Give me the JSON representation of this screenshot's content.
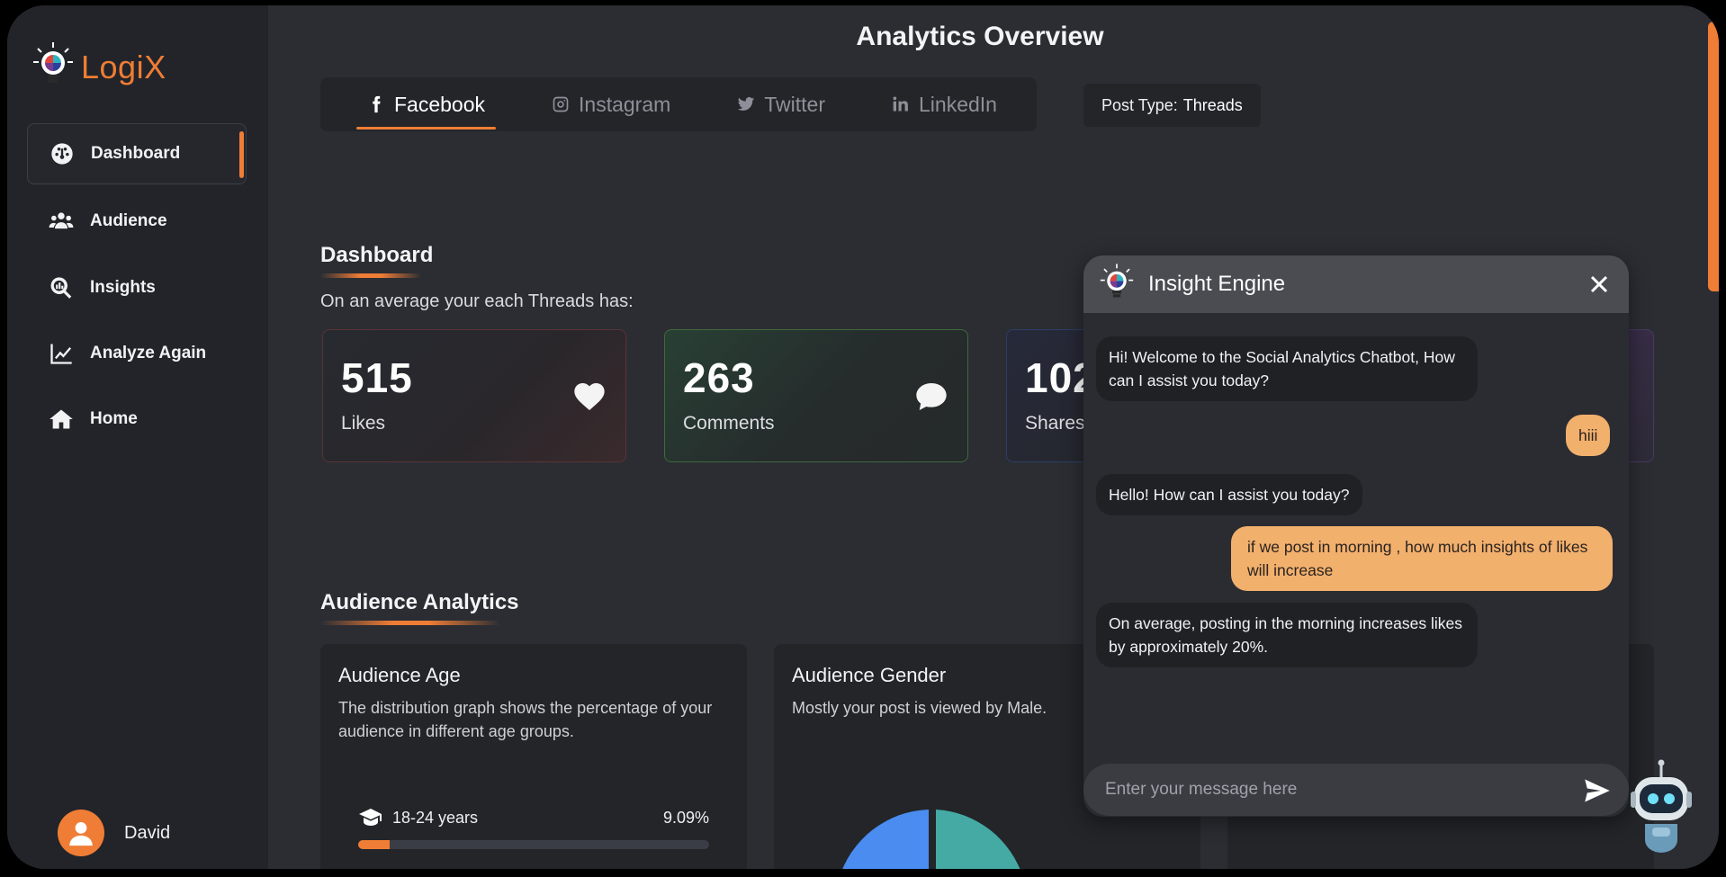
{
  "app": {
    "brand": "LogiX"
  },
  "sidebar": {
    "items": [
      {
        "label": "Dashboard",
        "icon": "dashboard-gauge-icon",
        "active": true
      },
      {
        "label": "Audience",
        "icon": "users-icon"
      },
      {
        "label": "Insights",
        "icon": "search-chart-icon"
      },
      {
        "label": "Analyze Again",
        "icon": "line-chart-icon"
      },
      {
        "label": "Home",
        "icon": "home-icon"
      }
    ],
    "user": {
      "name": "David"
    }
  },
  "header": {
    "title": "Analytics Overview"
  },
  "tabs": [
    {
      "label": "Facebook",
      "icon": "facebook-icon",
      "active": true
    },
    {
      "label": "Instagram",
      "icon": "instagram-icon"
    },
    {
      "label": "Twitter",
      "icon": "twitter-icon"
    },
    {
      "label": "LinkedIn",
      "icon": "linkedin-icon"
    }
  ],
  "post_type": {
    "label": "Post Type:",
    "value": "Threads"
  },
  "dashboard": {
    "title": "Dashboard",
    "subtitle": "On an average your each Threads has:",
    "stats": [
      {
        "value": "515",
        "label": "Likes",
        "icon": "heart-icon"
      },
      {
        "value": "263",
        "label": "Comments",
        "icon": "comment-icon"
      },
      {
        "value": "102",
        "label": "Shares",
        "icon": "share-icon"
      }
    ]
  },
  "audience": {
    "title": "Audience Analytics",
    "age_card": {
      "title": "Audience Age",
      "desc": "The distribution graph shows the percentage of your audience in different age groups.",
      "rows": [
        {
          "label": "18-24 years",
          "percent": "9.09%",
          "fraction": 0.0909
        }
      ]
    },
    "gender_card": {
      "title": "Audience Gender",
      "desc": "Mostly your post is viewed by Male."
    }
  },
  "chat": {
    "title": "Insight Engine",
    "messages": [
      {
        "from": "bot",
        "text": "Hi! Welcome to the Social Analytics Chatbot, How can I assist you today?"
      },
      {
        "from": "me",
        "text": "hiii"
      },
      {
        "from": "bot",
        "text": "Hello! How can I assist you today?"
      },
      {
        "from": "me",
        "text": "if we post in morning , how much insights of likes will increase"
      },
      {
        "from": "bot",
        "text": "On average, posting in the morning increases likes by approximately 20%."
      }
    ],
    "input_placeholder": "Enter your message here"
  },
  "colors": {
    "accent": "#ef7d35",
    "user_bubble": "#f2b06d",
    "bg": "#2b2d33",
    "sidebar": "#222429"
  }
}
